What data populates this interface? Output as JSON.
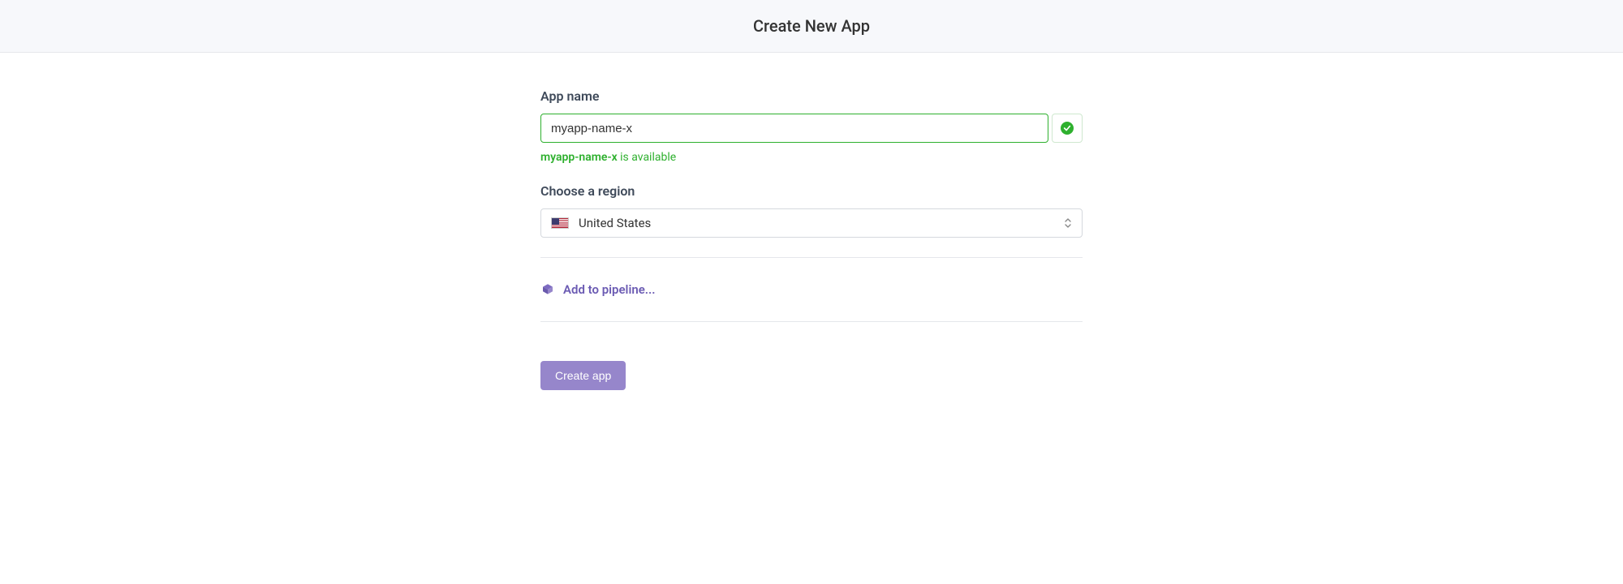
{
  "header": {
    "title": "Create New App"
  },
  "form": {
    "appNameLabel": "App name",
    "appNameValue": "myapp-name-x",
    "availabilityName": "myapp-name-x",
    "availabilitySuffix": " is available",
    "regionLabel": "Choose a region",
    "regionValue": "United States",
    "pipelineText": "Add to pipeline...",
    "createButton": "Create app"
  }
}
